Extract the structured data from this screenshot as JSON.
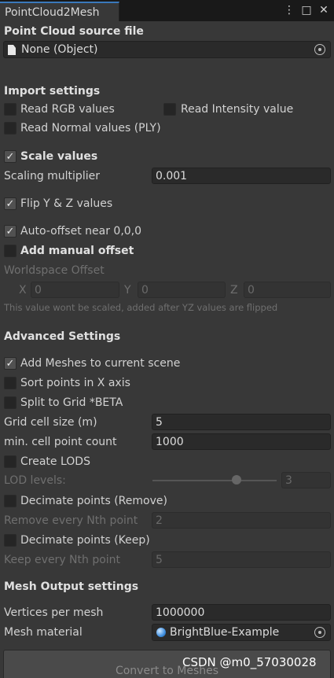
{
  "window": {
    "tab_title": "PointCloud2Mesh",
    "menu_glyph": "⋮",
    "maximize_glyph": "□",
    "close_glyph": "✕"
  },
  "source": {
    "heading": "Point Cloud source file",
    "object_value": "None (Object)",
    "object_icon": "file-icon"
  },
  "import": {
    "heading": "Import settings",
    "read_rgb": {
      "label": "Read RGB values",
      "checked": false
    },
    "read_intensity": {
      "label": "Read Intensity value",
      "checked": false
    },
    "read_normal": {
      "label": "Read Normal values (PLY)",
      "checked": false
    },
    "scale_values": {
      "label": "Scale values",
      "checked": true
    },
    "scaling_multiplier": {
      "label": "Scaling multiplier",
      "value": "0.001"
    },
    "flip_yz": {
      "label": "Flip Y & Z values",
      "checked": true
    },
    "auto_offset": {
      "label": "Auto-offset near 0,0,0",
      "checked": true
    },
    "manual_offset": {
      "label": "Add manual offset",
      "checked": false
    },
    "worldspace_offset": {
      "label": "Worldspace Offset",
      "x_label": "X",
      "x_value": "0",
      "y_label": "Y",
      "y_value": "0",
      "z_label": "Z",
      "z_value": "0"
    },
    "offset_note": "This value wont be scaled, added after YZ values are flipped"
  },
  "advanced": {
    "heading": "Advanced Settings",
    "add_meshes": {
      "label": "Add Meshes to current scene",
      "checked": true
    },
    "sort_points": {
      "label": "Sort points in X axis",
      "checked": false
    },
    "split_grid": {
      "label": "Split to Grid *BETA",
      "checked": false
    },
    "grid_cell_size": {
      "label": "Grid cell size (m)",
      "value": "5"
    },
    "min_cell_count": {
      "label": "min. cell point count",
      "value": "1000"
    },
    "create_lods": {
      "label": "Create LODS",
      "checked": false
    },
    "lod_levels": {
      "label": "LOD levels:",
      "value": "3"
    },
    "decimate_remove": {
      "label": "Decimate points (Remove)",
      "checked": false
    },
    "remove_nth": {
      "label": "Remove every Nth point",
      "value": "2"
    },
    "decimate_keep": {
      "label": "Decimate points (Keep)",
      "checked": false
    },
    "keep_nth": {
      "label": "Keep every Nth point",
      "value": "5"
    }
  },
  "output": {
    "heading": "Mesh Output settings",
    "vertices_per_mesh": {
      "label": "Vertices per mesh",
      "value": "1000000"
    },
    "mesh_material": {
      "label": "Mesh material",
      "value": "BrightBlue-Example",
      "icon": "material-sphere-icon"
    }
  },
  "actions": {
    "convert_label": "Convert to Meshes"
  },
  "watermark": "CSDN @m0_57030028",
  "colors": {
    "background": "#383838",
    "field": "#2a2a2a",
    "accent_tab": "#3a79bb",
    "checkbox_on": "#515151"
  }
}
